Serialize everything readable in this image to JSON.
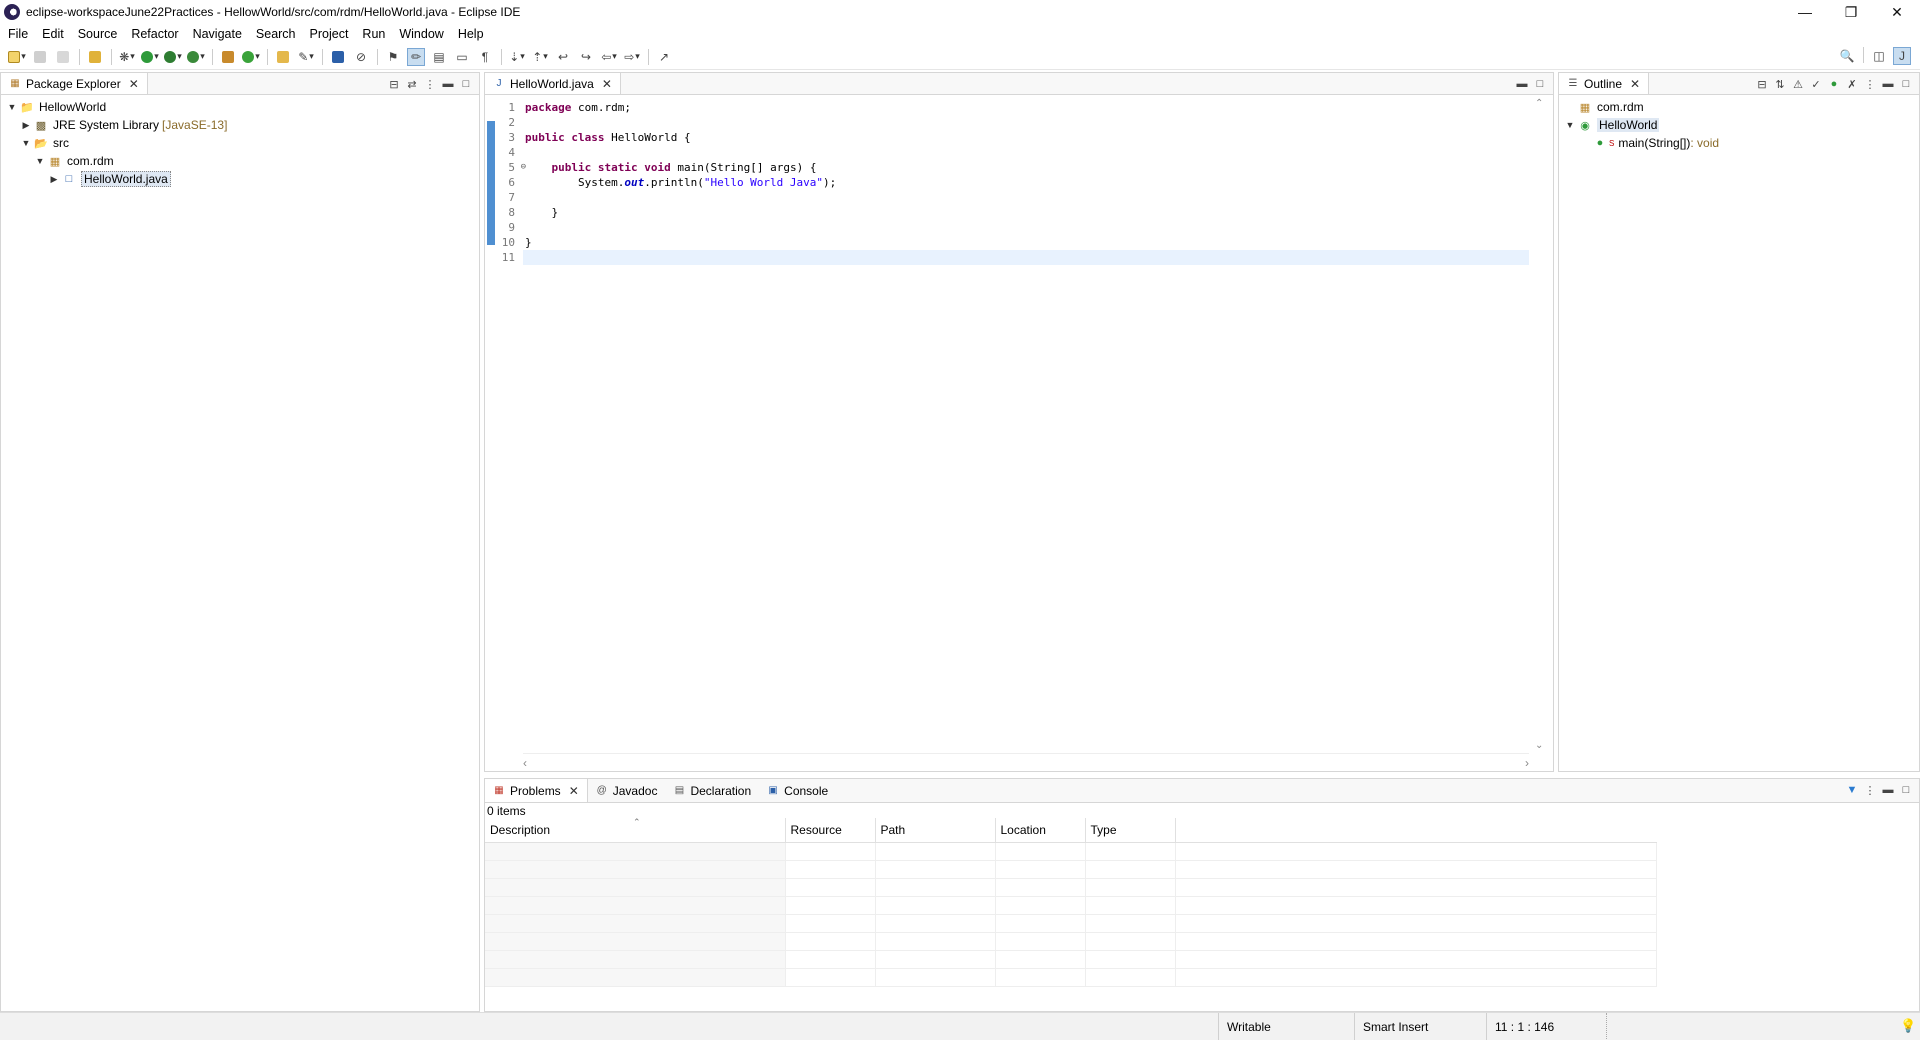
{
  "window": {
    "title": "eclipse-workspaceJune22Practices - HellowWorld/src/com/rdm/HelloWorld.java - Eclipse IDE"
  },
  "menu": [
    "File",
    "Edit",
    "Source",
    "Refactor",
    "Navigate",
    "Search",
    "Project",
    "Run",
    "Window",
    "Help"
  ],
  "package_explorer": {
    "tab_label": "Package Explorer",
    "tree": {
      "project": "HellowWorld",
      "jre": "JRE System Library",
      "jre_decor": "[JavaSE-13]",
      "src": "src",
      "package": "com.rdm",
      "file": "HelloWorld.java"
    }
  },
  "editor": {
    "tab_label": "HelloWorld.java",
    "line_numbers": [
      "1",
      "2",
      "3",
      "4",
      "5",
      "6",
      "7",
      "8",
      "9",
      "10",
      "11"
    ],
    "code": {
      "l1_kw": "package",
      "l1_rest": " com.rdm;",
      "l3_kw1": "public",
      "l3_kw2": "class",
      "l3_rest": " HelloWorld {",
      "l5_kw1": "public",
      "l5_kw2": "static",
      "l5_kw3": "void",
      "l5_rest": " main(String[] args) {",
      "l6_pre": "        System.",
      "l6_field": "out",
      "l6_mid": ".println(",
      "l6_str": "\"Hello World Java\"",
      "l6_post": ");",
      "l8": "    }",
      "l10": "}"
    }
  },
  "outline": {
    "tab_label": "Outline",
    "package": "com.rdm",
    "class": "HelloWorld",
    "method": "main(String[])",
    "method_type": " : void",
    "method_decor": "S"
  },
  "bottom_panel": {
    "tabs": [
      "Problems",
      "Javadoc",
      "Declaration",
      "Console"
    ],
    "items_count": "0 items",
    "columns": [
      "Description",
      "Resource",
      "Path",
      "Location",
      "Type"
    ]
  },
  "status": {
    "writable": "Writable",
    "insert_mode": "Smart Insert",
    "position": "11 : 1 : 146"
  },
  "colors": {
    "keyword": "#7f0055",
    "string": "#2a00ff",
    "field": "#0000c0",
    "selection_bar": "#4f8fd1"
  }
}
